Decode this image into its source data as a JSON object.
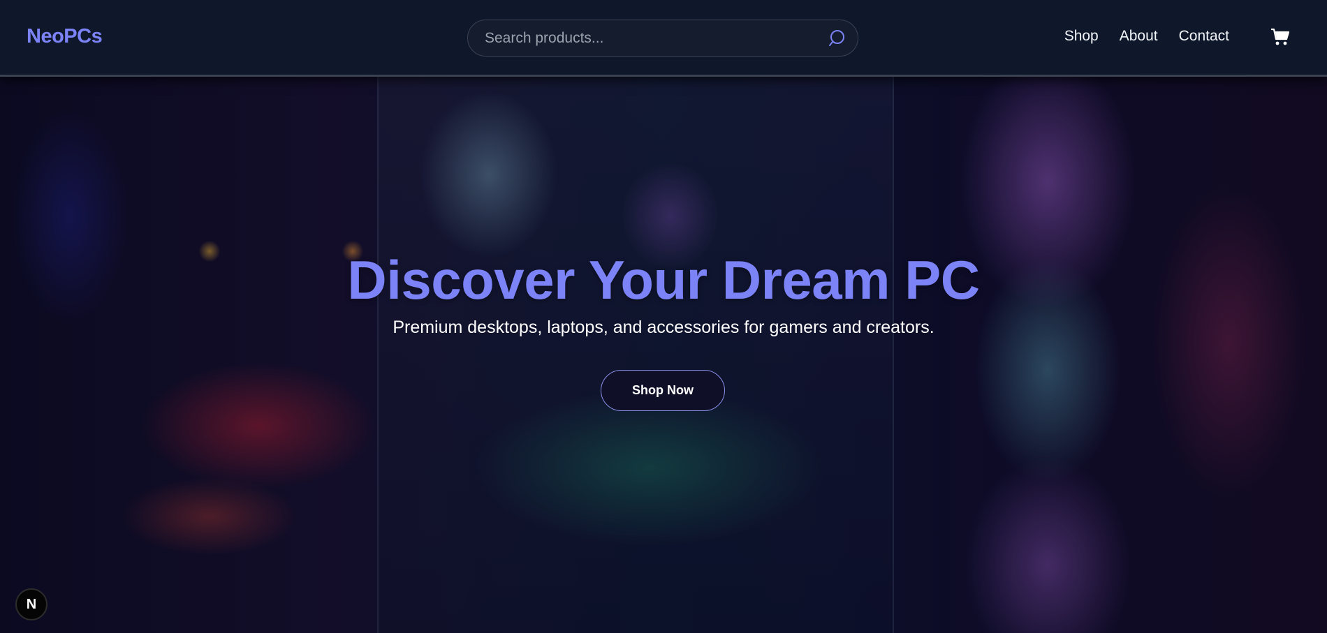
{
  "header": {
    "logo": "NeoPCs",
    "search": {
      "placeholder": "Search products...",
      "icon": "search-icon"
    },
    "nav": [
      {
        "label": "Shop"
      },
      {
        "label": "About"
      },
      {
        "label": "Contact"
      }
    ],
    "cart_icon": "cart-icon"
  },
  "hero": {
    "title": "Discover Your Dream PC",
    "subtitle": "Premium desktops, laptops, and accessories for gamers and creators.",
    "cta_label": "Shop Now"
  },
  "dev_badge": {
    "label": "N"
  },
  "colors": {
    "accent": "#7c83f7",
    "header_bg": "#0f172a",
    "text": "#ffffff"
  }
}
